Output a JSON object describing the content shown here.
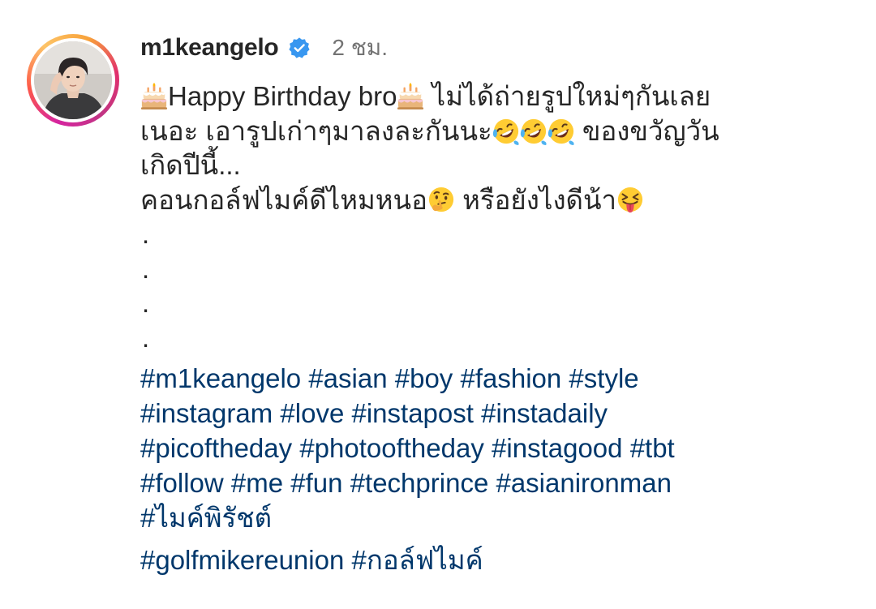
{
  "post": {
    "username": "m1keangelo",
    "time_ago": "2 ชม.",
    "caption": {
      "line1_part1": "Happy Birthday bro",
      "line1_part2": " ไม่ได้ถ่ายรูปใหม่ๆกันเลย",
      "line2_part1": "เนอะ เอารูปเก่าๆมาลงละกันนะ",
      "line2_part2": " ของขวัญวัน",
      "line3": "เกิดปีนี้...",
      "line4_part1": "คอนกอล์ฟไมค์ดีไหมหนอ",
      "line4_part2": " หรือยังไงดีน้า",
      "dots": [
        ".",
        ".",
        ".",
        "."
      ]
    },
    "hashtag_lines": [
      [
        "#m1keangelo",
        "#asian",
        "#boy",
        "#fashion",
        "#style"
      ],
      [
        "#instagram",
        "#love",
        "#instapost",
        "#instadaily"
      ],
      [
        "#picoftheday",
        "#photooftheday",
        "#instagood",
        "#tbt"
      ],
      [
        "#follow",
        "#me",
        "#fun",
        "#techprince",
        "#asianironman"
      ],
      [
        "#ไมค์พิรัชต์"
      ],
      [
        "#golfmikereunion",
        "#กอล์ฟไมค์"
      ]
    ],
    "emojis": {
      "cake": "birthday-cake-icon",
      "laugh": "rolling-on-floor-laughing-icon",
      "thinking": "thinking-face-icon",
      "tongue": "squinting-face-with-tongue-icon"
    },
    "colors": {
      "text": "#262626",
      "meta": "#737373",
      "hashtag": "#00376b",
      "verified": "#3897f0"
    }
  }
}
